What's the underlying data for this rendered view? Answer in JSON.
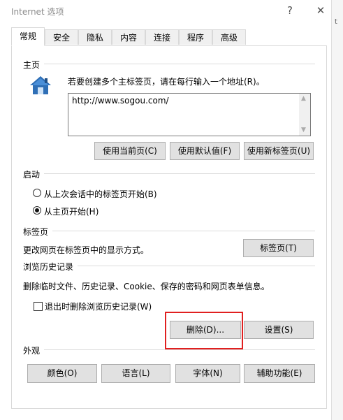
{
  "window": {
    "title": "Internet 选项",
    "help_glyph": "?",
    "close_glyph": "✕",
    "outer_strip_text": "t"
  },
  "tabs": [
    {
      "label": "常规",
      "active": true
    },
    {
      "label": "安全"
    },
    {
      "label": "隐私"
    },
    {
      "label": "内容"
    },
    {
      "label": "连接"
    },
    {
      "label": "程序"
    },
    {
      "label": "高级"
    }
  ],
  "homepage": {
    "group_label": "主页",
    "instruction": "若要创建多个主标签页，请在每行输入一个地址(R)。",
    "url_value": "http://www.sogou.com/",
    "btn_current": "使用当前页(C)",
    "btn_default": "使用默认值(F)",
    "btn_new_tab": "使用新标签页(U)"
  },
  "startup": {
    "group_label": "启动",
    "option_last_session": "从上次会话中的标签页开始(B)",
    "option_homepage": "从主页开始(H)",
    "selected": "homepage"
  },
  "tabs_section": {
    "group_label": "标签页",
    "description": "更改网页在标签页中的显示方式。",
    "btn_tabs": "标签页(T)"
  },
  "history": {
    "group_label": "浏览历史记录",
    "description": "删除临时文件、历史记录、Cookie、保存的密码和网页表单信息。",
    "checkbox_label": "退出时删除浏览历史记录(W)",
    "checkbox_checked": false,
    "btn_delete": "删除(D)...",
    "btn_settings": "设置(S)"
  },
  "appearance": {
    "group_label": "外观",
    "btn_colors": "颜色(O)",
    "btn_languages": "语言(L)",
    "btn_fonts": "字体(N)",
    "btn_accessibility": "辅助功能(E)"
  },
  "colors": {
    "highlight": "#e02020",
    "button_bg": "#e1e1e1",
    "button_border": "#adadad",
    "icon_blue": "#2f6fb6"
  }
}
